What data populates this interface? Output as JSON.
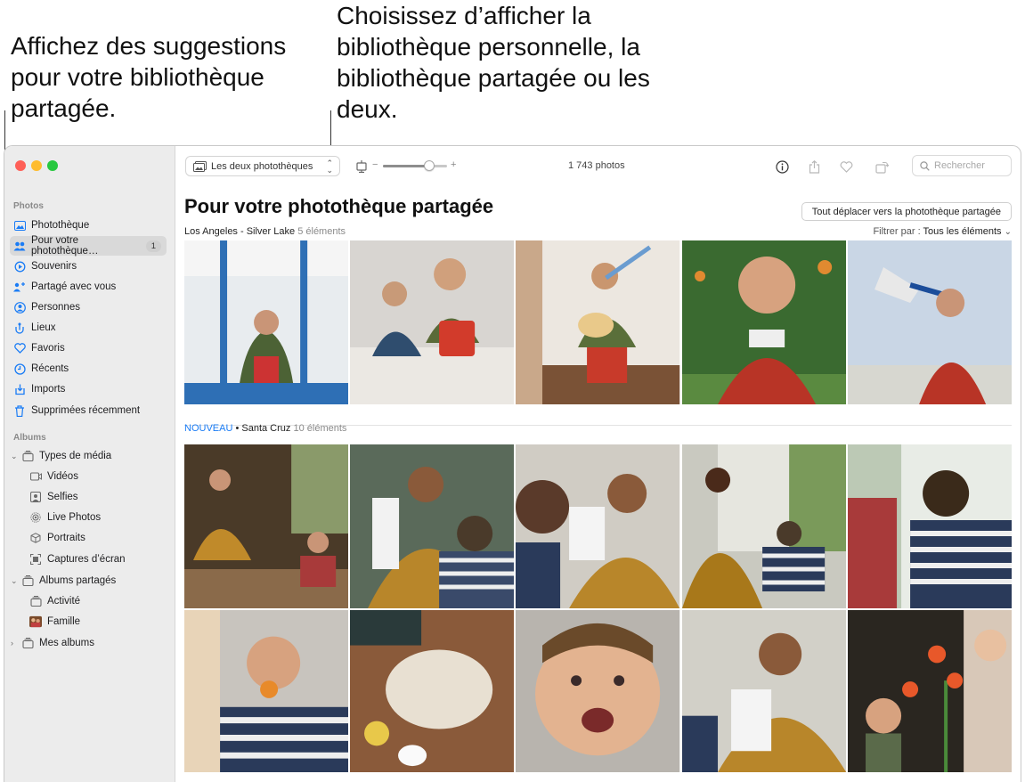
{
  "callouts": {
    "left": "Affichez des suggestions pour votre bibliothèque partagée.",
    "right": "Choisissez d’afficher la bibliothèque personnelle, la bibliothèque partagée ou les deux."
  },
  "sidebar": {
    "section_photos": "Photos",
    "section_albums": "Albums",
    "items": [
      {
        "label": "Photothèque",
        "icon": "library-icon"
      },
      {
        "label": "Pour votre photothèque…",
        "icon": "people-icon",
        "badge": "1"
      },
      {
        "label": "Souvenirs",
        "icon": "memories-icon"
      },
      {
        "label": "Partagé avec vous",
        "icon": "shared-with-you-icon"
      },
      {
        "label": "Personnes",
        "icon": "person-icon"
      },
      {
        "label": "Lieux",
        "icon": "pin-icon"
      },
      {
        "label": "Favoris",
        "icon": "heart-icon"
      },
      {
        "label": "Récents",
        "icon": "clock-icon"
      },
      {
        "label": "Imports",
        "icon": "import-icon"
      },
      {
        "label": "Supprimées récemment",
        "icon": "trash-icon"
      }
    ],
    "albums": [
      {
        "label": "Types de média",
        "icon": "stack-icon"
      },
      {
        "label": "Vidéos",
        "icon": "video-icon"
      },
      {
        "label": "Selfies",
        "icon": "selfie-icon"
      },
      {
        "label": "Live Photos",
        "icon": "live-photo-icon"
      },
      {
        "label": "Portraits",
        "icon": "cube-icon"
      },
      {
        "label": "Captures d’écran",
        "icon": "screenshot-icon"
      },
      {
        "label": "Albums partagés",
        "icon": "stack-icon"
      },
      {
        "label": "Activité",
        "icon": "activity-icon"
      },
      {
        "label": "Famille",
        "icon": "family-thumbnail"
      },
      {
        "label": "Mes albums",
        "icon": "stack-icon"
      }
    ]
  },
  "toolbar": {
    "library_selector": "Les deux photothèques",
    "zoom_minus": "−",
    "zoom_plus": "+",
    "zoom_level": 0.72,
    "photo_count": "1 743 photos",
    "search_placeholder": "Rechercher"
  },
  "main": {
    "title": "Pour votre photothèque partagée",
    "move_all_button": "Tout déplacer vers la photothèque partagée",
    "group1": {
      "place": "Los Angeles - Silver Lake",
      "count": "5 éléments"
    },
    "filter_label": "Filtrer par :",
    "filter_value": "Tous les éléments",
    "group2": {
      "tag": "NOUVEAU",
      "sep": " • ",
      "place": "Santa Cruz",
      "count": "10 éléments"
    }
  },
  "colors": {
    "accent": "#1a7cf5",
    "traffic_red": "#fe5f57",
    "traffic_yellow": "#febc2e",
    "traffic_green": "#28c840"
  }
}
